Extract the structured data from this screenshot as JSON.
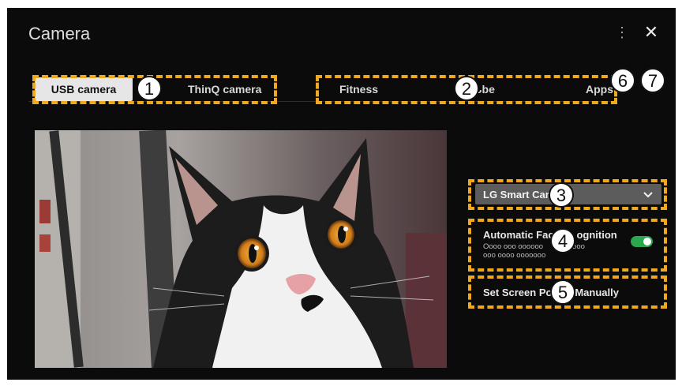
{
  "header": {
    "title": "Camera",
    "more_icon": "⋮",
    "close_icon": "✕"
  },
  "tabs": [
    {
      "label": "USB camera",
      "active": true
    },
    {
      "label": "ThinQ camera",
      "active": false
    },
    {
      "label": "Fitness",
      "active": false
    },
    {
      "label": "ᴗbe",
      "active": false
    },
    {
      "label": "Apps",
      "active": false
    }
  ],
  "camera_select": {
    "label": "LG Smart Cam",
    "icon": "chevron-down-icon"
  },
  "face_recognition": {
    "title": "Automatic Fac        ognition",
    "description": "Oooo ooo oooooo          ooooo\nooo oooo ooooooo",
    "enabled": true
  },
  "screen_position": {
    "label": "Set Screen Po        Manually"
  },
  "callouts": [
    "1",
    "2",
    "3",
    "4",
    "5",
    "6",
    "7"
  ],
  "colors": {
    "background": "#0b0b0b",
    "highlight_dash": "#f0a81c",
    "toggle_on": "#2aa74f",
    "select_bg": "#5c5c5c"
  }
}
